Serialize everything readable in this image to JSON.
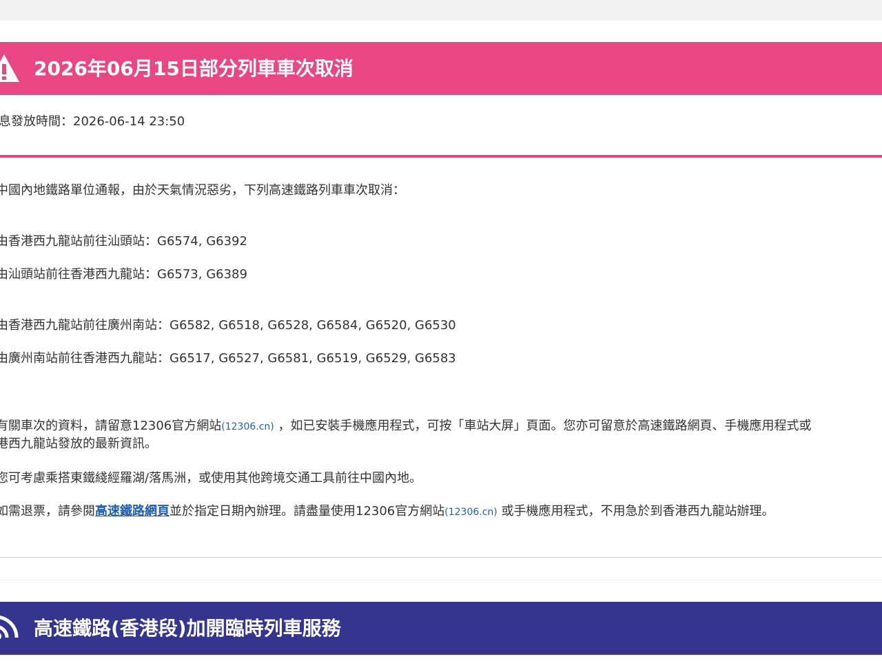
{
  "colors": {
    "alert_banner": "#e84784",
    "next_banner": "#33358e",
    "link": "#1f5fb5",
    "text": "#333333"
  },
  "alert": {
    "icon": "warning-icon",
    "title": "2026年06月15日部分列車車次取消",
    "release_time_label": "息發放時間：",
    "release_time_value": "2026-06-14 23:50"
  },
  "body": {
    "intro": "中國內地鐵路單位通報，由於天氣情況惡劣，下列高速鐵路列車車次取消：",
    "routes": [
      {
        "prefix": "由香港西九龍站前往汕頭站：",
        "trains": "G6574, G6392"
      },
      {
        "prefix": "由汕頭站前往香港西九龍站：",
        "trains": "G6573, G6389"
      },
      {
        "prefix": "由香港西九龍站前往廣州南站：",
        "trains": "G6582, G6518, G6528, G6584, G6520, G6530"
      },
      {
        "prefix": "由廣州南站前往香港西九龍站：",
        "trains": "G6517, G6527, G6581, G6519, G6529, G6583"
      }
    ],
    "info_part1": "有關車次的資料，請留意12306官方網站",
    "info_link": "(12306.cn)",
    "info_part2": "，如已安裝手機應用程式，可按「車站大屏」頁面。您亦可留意於高速鐵路網頁、手機應用程式或",
    "info_line2": "港西九龍站發放的最新資訊。",
    "alt_transport": "您可考慮乘搭東鐵綫經羅湖/落馬洲，或使用其他跨境交通工具前往中國內地。",
    "refund_part1": "如需退票，請參閱",
    "refund_link": "高速鐵路網頁",
    "refund_part2": "並於指定日期內辦理。請盡量使用12306官方網站",
    "refund_link2": "(12306.cn)",
    "refund_part3": "或手機應用程式，不用急於到香港西九龍站辦理。"
  },
  "next_notice": {
    "icon": "broadcast-icon",
    "title": "高速鐵路(香港段)加開臨時列車服務"
  }
}
